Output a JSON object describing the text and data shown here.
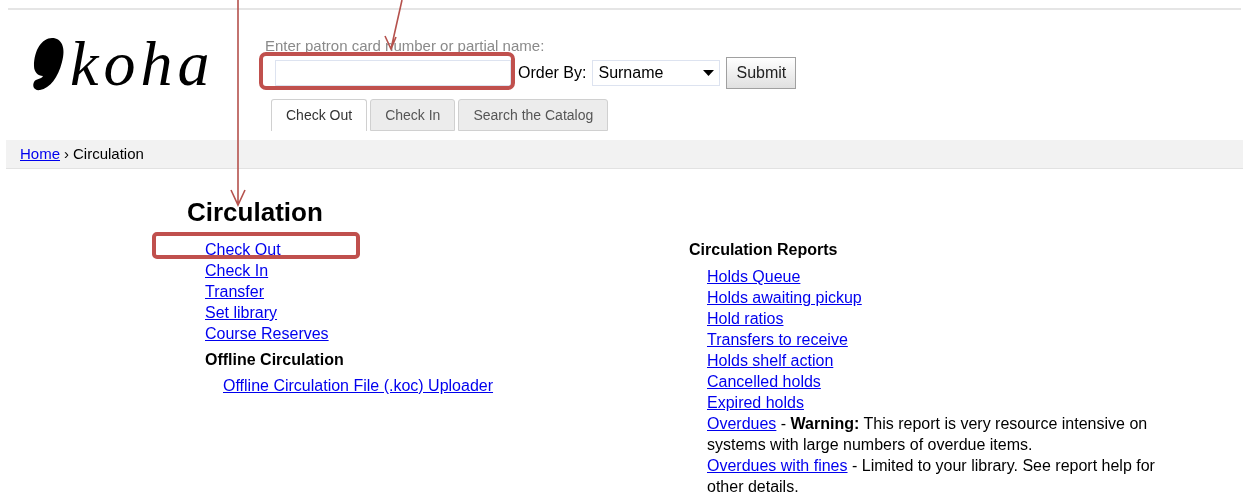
{
  "logo": {
    "text": "koha"
  },
  "search": {
    "label": "Enter patron card number or partial name:",
    "order_label": "Order By:",
    "order_value": "Surname",
    "submit": "Submit"
  },
  "tabs": [
    {
      "label": "Check Out",
      "selected": true
    },
    {
      "label": "Check In",
      "selected": false
    },
    {
      "label": "Search the Catalog",
      "selected": false
    }
  ],
  "breadcrumb": {
    "home": "Home",
    "separator": "›",
    "current": "Circulation"
  },
  "title": "Circulation",
  "circulation_links": [
    "Check Out",
    "Check In",
    "Transfer",
    "Set library",
    "Course Reserves"
  ],
  "offline": {
    "heading": "Offline Circulation",
    "links": [
      "Offline Circulation File (.koc) Uploader"
    ]
  },
  "reports": {
    "heading": "Circulation Reports",
    "items": [
      {
        "link": "Holds Queue"
      },
      {
        "link": "Holds awaiting pickup"
      },
      {
        "link": "Hold ratios"
      },
      {
        "link": "Transfers to receive"
      },
      {
        "link": "Holds shelf action"
      },
      {
        "link": "Cancelled holds"
      },
      {
        "link": "Expired holds"
      },
      {
        "link": "Overdues",
        "description": "- **Warning:** This report is very resource intensive on systems with large numbers of overdue items."
      },
      {
        "link": "Overdues with fines",
        "description": "- Limited to your library. See report help for other details."
      }
    ]
  }
}
